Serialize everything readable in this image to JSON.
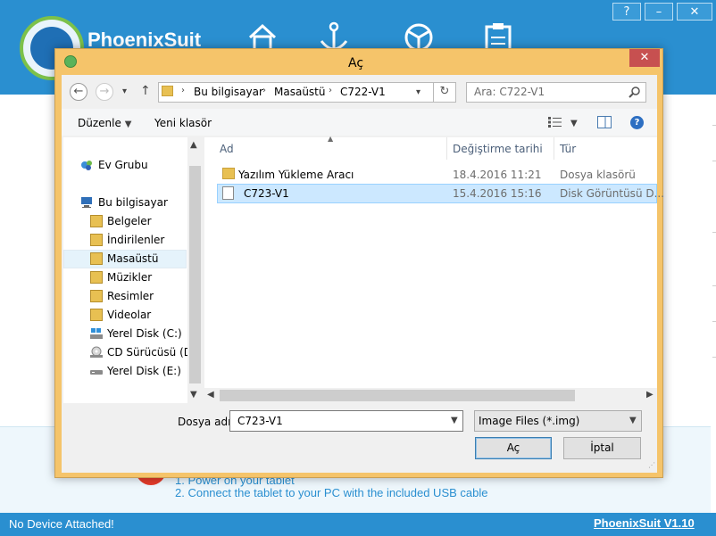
{
  "app": {
    "brand": "PhoenixSuit",
    "steps": [
      "1. Power on your tablet",
      "2. Connect the tablet to your PC with the included USB cable"
    ],
    "status_text": "No Device Attached!",
    "version": "PhoenixSuit V1.10",
    "window_controls": [
      "?",
      "–",
      "✕"
    ]
  },
  "dialog": {
    "title": "Aç",
    "close": "✕",
    "address": {
      "back": "←",
      "forward": "→",
      "recent": "▾",
      "up": "↑",
      "crumbs": [
        "Bu bilgisayar",
        "Masaüstü",
        "C722-V1"
      ],
      "refresh": "↻",
      "search_placeholder": "Ara: C722-V1",
      "search_icon": "search-icon"
    },
    "toolbar": {
      "organize": "Düzenle",
      "new_folder": "Yeni klasör"
    },
    "nav": [
      {
        "label": "Ev Grubu",
        "icon": "homegroup-icon"
      },
      {
        "label": "Bu bilgisayar",
        "icon": "computer-icon"
      },
      {
        "label": "Belgeler",
        "icon": "documents-icon"
      },
      {
        "label": "İndirilenler",
        "icon": "downloads-icon"
      },
      {
        "label": "Masaüstü",
        "icon": "desktop-folder-icon"
      },
      {
        "label": "Müzikler",
        "icon": "music-icon"
      },
      {
        "label": "Resimler",
        "icon": "pictures-icon"
      },
      {
        "label": "Videolar",
        "icon": "videos-icon"
      },
      {
        "label": "Yerel Disk (C:)",
        "icon": "drive-icon"
      },
      {
        "label": "CD Sürücüsü (D:)",
        "icon": "cd-drive-icon"
      },
      {
        "label": "Yerel Disk (E:)",
        "icon": "drive-icon"
      }
    ],
    "columns": [
      "Ad",
      "Değiştirme tarihi",
      "Tür"
    ],
    "files": [
      {
        "name": "Yazılım Yükleme Aracı",
        "date": "18.4.2016 11:21",
        "type": "Dosya klasörü"
      },
      {
        "name": "C723-V1",
        "date": "15.4.2016 15:16",
        "type": "Disk Görüntüsü D..."
      }
    ],
    "filename_label": "Dosya adı:",
    "filename_value": "C723-V1",
    "filetype_value": "Image Files (*.img)",
    "open_label": "Aç",
    "cancel_label": "İptal"
  },
  "colors": {
    "app_blue": "#2a8fd0",
    "dialog_frame": "#f5c46a",
    "selection": "#cce8ff",
    "close_red": "#c75050"
  }
}
